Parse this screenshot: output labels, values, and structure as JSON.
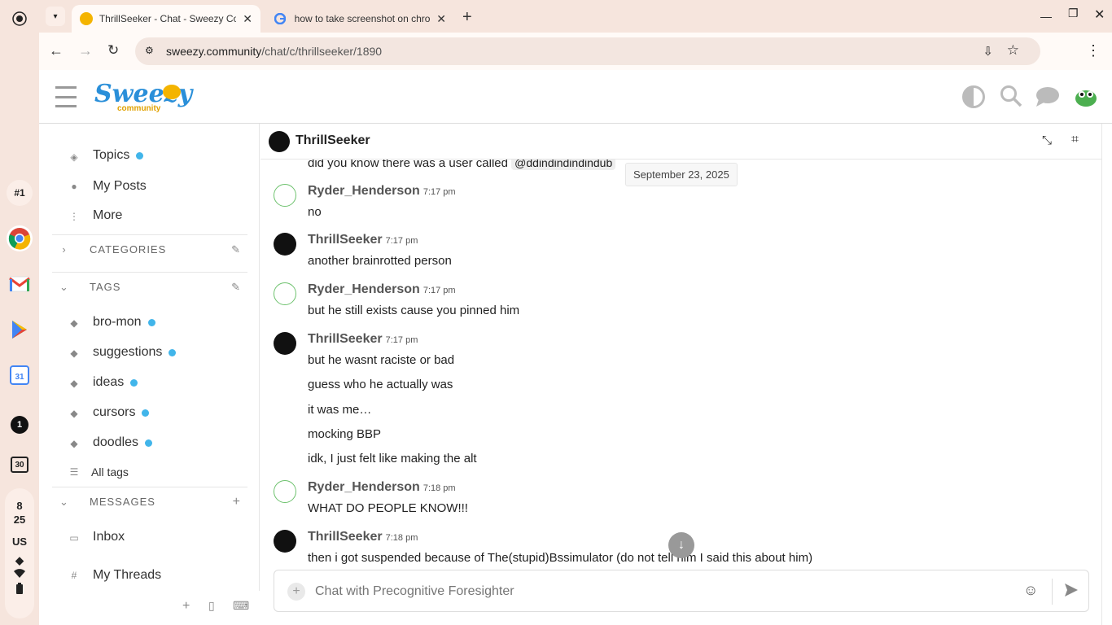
{
  "shelf": {
    "badge_rank": "#1",
    "badge_one": "1",
    "calendar_day": "30",
    "time_hour": "8",
    "time_min": "25",
    "locale": "US"
  },
  "browser": {
    "tabs": [
      {
        "title": "ThrillSeeker - Chat - Sweezy Co"
      },
      {
        "title": "how to take screenshot on chro"
      }
    ],
    "url_host": "sweezy.community",
    "url_path": "/chat/c/thrillseeker/1890"
  },
  "header": {
    "logo_main": "Sweezy",
    "logo_sub": "community"
  },
  "sidebar": {
    "nav": [
      {
        "label": "Topics",
        "icon": "stack-icon",
        "dot": true
      },
      {
        "label": "My Posts",
        "icon": "user-icon",
        "dot": false
      },
      {
        "label": "More",
        "icon": "vertical-dots-icon",
        "dot": false
      }
    ],
    "categories_label": "CATEGORIES",
    "tags_label": "TAGS",
    "tags": [
      {
        "label": "bro-mon"
      },
      {
        "label": "suggestions"
      },
      {
        "label": "ideas"
      },
      {
        "label": "cursors"
      },
      {
        "label": "doodles"
      }
    ],
    "all_tags": "All tags",
    "messages_label": "MESSAGES",
    "inbox": "Inbox",
    "my_threads": "My Threads"
  },
  "chat": {
    "channel_name": "ThrillSeeker",
    "date_divider": "September 23, 2025",
    "partial_top": "did you know there was a user called",
    "partial_mention": "@ddindindindindub",
    "messages": [
      {
        "author": "Ryder_Henderson",
        "time": "7:17 pm",
        "avatar": "green",
        "lines": [
          "no"
        ]
      },
      {
        "author": "ThrillSeeker",
        "time": "7:17 pm",
        "avatar": "dark",
        "lines": [
          "another brainrotted person"
        ]
      },
      {
        "author": "Ryder_Henderson",
        "time": "7:17 pm",
        "avatar": "green",
        "lines": [
          "but he still exists cause you pinned him"
        ]
      },
      {
        "author": "ThrillSeeker",
        "time": "7:17 pm",
        "avatar": "dark",
        "lines": [
          "but he wasnt raciste or bad",
          "guess who he actually was",
          "it was me…",
          "mocking BBP",
          "idk, I just felt like making the alt"
        ]
      },
      {
        "author": "Ryder_Henderson",
        "time": "7:18 pm",
        "avatar": "green",
        "lines": [
          "WHAT DO PEOPLE KNOW!!!"
        ]
      },
      {
        "author": "ThrillSeeker",
        "time": "7:18 pm",
        "avatar": "dark",
        "lines": [
          "then i got suspended because of The(stupid)Bssimulator (do not tell him I said this about him)"
        ]
      }
    ],
    "composer_placeholder": "Chat with Precognitive Foresighter"
  },
  "colors": {
    "accent_blue": "#41b5ea",
    "chrome_bg": "#f6e5dd"
  }
}
